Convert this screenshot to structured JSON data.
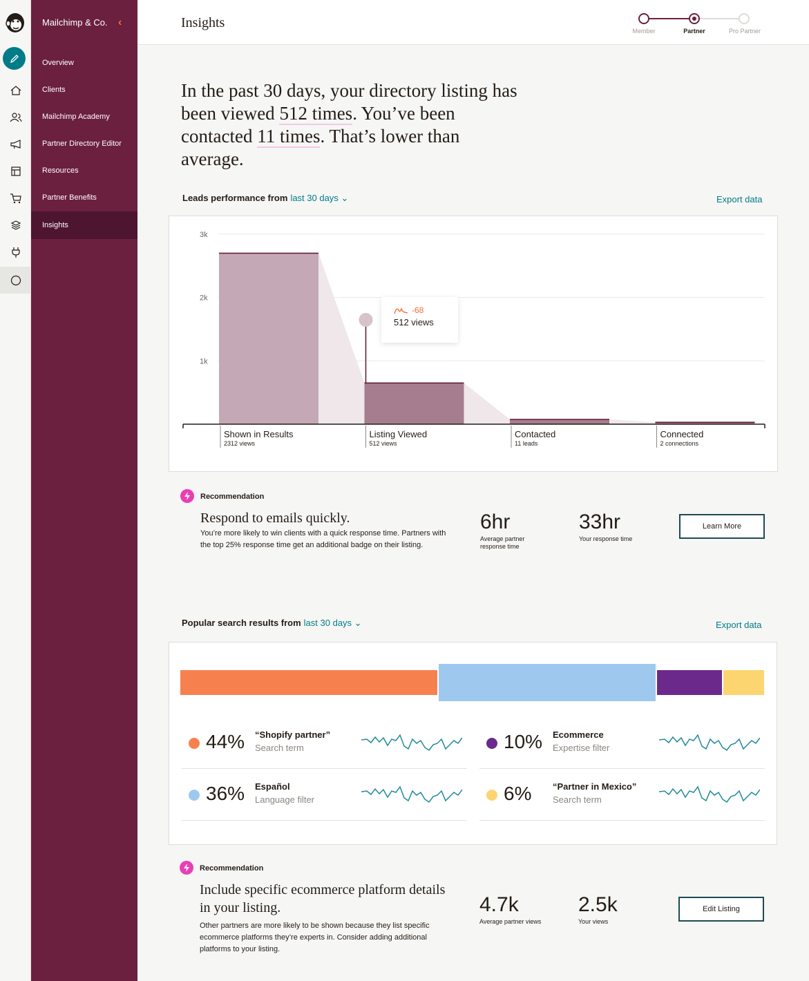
{
  "sidebar": {
    "account": "Mailchimp & Co.",
    "items": [
      {
        "label": "Overview"
      },
      {
        "label": "Clients"
      },
      {
        "label": "Mailchimp Academy"
      },
      {
        "label": "Partner Directory Editor"
      },
      {
        "label": "Resources"
      },
      {
        "label": "Partner Benefits"
      },
      {
        "label": "Insights",
        "active": true
      }
    ]
  },
  "rail_icons": [
    "mailchimp-logo-icon",
    "pencil-icon",
    "home-icon",
    "audience-icon",
    "megaphone-icon",
    "layout-icon",
    "cart-icon",
    "layers-icon",
    "plug-icon",
    "circle-icon"
  ],
  "header": {
    "title": "Insights",
    "steps": [
      {
        "label": "Member",
        "state": "complete"
      },
      {
        "label": "Partner",
        "state": "current"
      },
      {
        "label": "Pro Partner",
        "state": "upcoming"
      }
    ]
  },
  "hero": {
    "p1": "In the past 30 days, your directory listing has been viewed ",
    "views": "512 times",
    "p2": ". You’ve been contacted ",
    "contacts": "11 times",
    "p3": ". That’s lower than average."
  },
  "leads": {
    "title": "Leads performance from",
    "range": "last 30 days",
    "export": "Export data",
    "tooltip": {
      "delta": "-68",
      "views": "512 views"
    }
  },
  "chart_data": {
    "type": "bar",
    "categories": [
      "Shown in Results",
      "Listing Viewed",
      "Contacted",
      "Connected"
    ],
    "sublabels": [
      "2312 views",
      "512 views",
      "11 leads",
      "2 connections"
    ],
    "values": [
      2700,
      650,
      75,
      30
    ],
    "yticks": [
      "1k",
      "2k",
      "3k"
    ],
    "ylim": [
      0,
      3000
    ],
    "title": "",
    "xlabel": "",
    "ylabel": ""
  },
  "rec1": {
    "label": "Recommendation",
    "heading": "Respond to emails quickly.",
    "body": "You’re more likely to win clients with a quick response time. Partners with the top 25% response time get an additional badge on their listing.",
    "stat1": {
      "value": "6hr",
      "caption": "Average partner response time"
    },
    "stat2": {
      "value": "33hr",
      "caption": "Your response time"
    },
    "button": "Learn More"
  },
  "search": {
    "title": "Popular search results from",
    "range": "last 30 days",
    "export": "Export data",
    "colors": [
      "#f6814f",
      "#9fc8ef",
      "#6b2a8b",
      "#fcd571"
    ],
    "rows": [
      {
        "pct": "44%",
        "term": "“Shopify partner”",
        "kind": "Search term",
        "color": "#f6814f"
      },
      {
        "pct": "10%",
        "term": "Ecommerce",
        "kind": "Expertise filter",
        "color": "#6b2a8b"
      },
      {
        "pct": "36%",
        "term": "Español",
        "kind": "Language filter",
        "color": "#9fc8ef"
      },
      {
        "pct": "6%",
        "term": "“Partner in Mexico”",
        "kind": "Search term",
        "color": "#fcd571"
      }
    ]
  },
  "rec2": {
    "label": "Recommendation",
    "heading": "Include specific ecommerce platform details in your listing.",
    "body": "Other partners are more likely to be shown because they list specific ecommerce platforms they’re experts in. Consider adding additional platforms to your listing.",
    "stat1": {
      "value": "4.7k",
      "caption": "Average partner views"
    },
    "stat2": {
      "value": "2.5k",
      "caption": "Your views"
    },
    "button": "Edit Listing"
  }
}
